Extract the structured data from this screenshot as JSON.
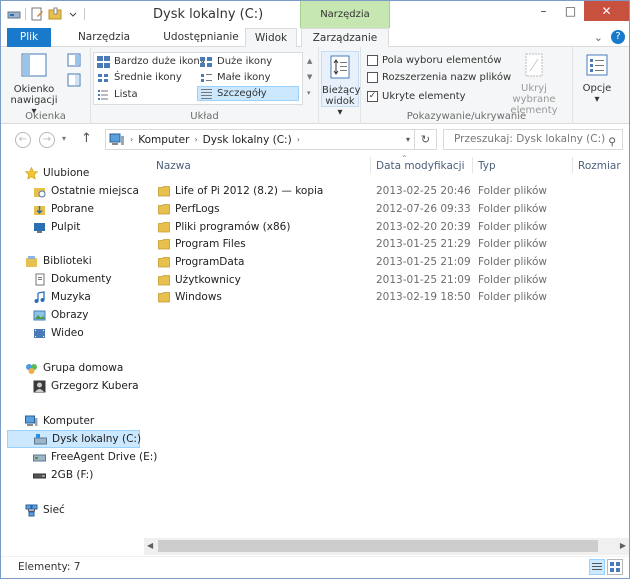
{
  "window": {
    "title": "Dysk lokalny (C:)",
    "context_tab": "Narzędzia dysków",
    "controls": {
      "minimize": "–",
      "maximize": "□",
      "close": "✕"
    }
  },
  "tabs": {
    "file": "Plik",
    "home": "Narzędzia główne",
    "share": "Udostępnianie",
    "view": "Widok",
    "manage": "Zarządzanie"
  },
  "ribbon": {
    "panes": {
      "label": "Okienka",
      "nav_pane_line1": "Okienko",
      "nav_pane_line2": "nawigacji"
    },
    "layout": {
      "label": "Układ",
      "items": {
        "extra_large": "Bardzo duże ikony",
        "large": "Duże ikony",
        "medium": "Średnie ikony",
        "small": "Małe ikony",
        "list": "Lista",
        "details": "Szczegóły"
      }
    },
    "current_view": {
      "line1": "Bieżący",
      "line2": "widok"
    },
    "show_hide": {
      "label": "Pokazywanie/ukrywanie",
      "item_checkboxes": "Pola wyboru elementów",
      "item_checkboxes_checked": false,
      "file_extensions": "Rozszerzenia nazw plików",
      "file_extensions_checked": false,
      "hidden_items": "Ukryte elementy",
      "hidden_items_checked": true,
      "hide_selected_line1": "Ukryj wybrane",
      "hide_selected_line2": "elementy"
    },
    "options": "Opcje"
  },
  "address": {
    "crumbs": [
      "Komputer",
      "Dysk lokalny (C:)"
    ],
    "search_placeholder": "Przeszukaj: Dysk lokalny (C:)"
  },
  "navigation": {
    "favorites": {
      "label": "Ulubione",
      "items": [
        "Ostatnie miejsca",
        "Pobrane",
        "Pulpit"
      ]
    },
    "libraries": {
      "label": "Biblioteki",
      "items": [
        "Dokumenty",
        "Muzyka",
        "Obrazy",
        "Wideo"
      ]
    },
    "homegroup": {
      "label": "Grupa domowa",
      "items": [
        "Grzegorz Kubera"
      ]
    },
    "computer": {
      "label": "Komputer",
      "items": [
        "Dysk lokalny (C:)",
        "FreeAgent Drive (E:)",
        "2GB (F:)"
      ]
    },
    "network": {
      "label": "Sieć"
    }
  },
  "columns": {
    "name": "Nazwa",
    "date": "Data modyfikacji",
    "type": "Typ",
    "size": "Rozmiar"
  },
  "files": [
    {
      "name": "Life of Pi 2012  (8.2) — kopia",
      "date": "2013-02-25 20:46",
      "type": "Folder plików"
    },
    {
      "name": "PerfLogs",
      "date": "2012-07-26 09:33",
      "type": "Folder plików"
    },
    {
      "name": "Pliki programów (x86)",
      "date": "2013-02-20 20:39",
      "type": "Folder plików"
    },
    {
      "name": "Program Files",
      "date": "2013-01-25 21:29",
      "type": "Folder plików"
    },
    {
      "name": "ProgramData",
      "date": "2013-01-25 21:09",
      "type": "Folder plików"
    },
    {
      "name": "Użytkownicy",
      "date": "2013-01-25 21:09",
      "type": "Folder plików"
    },
    {
      "name": "Windows",
      "date": "2013-02-19 18:50",
      "type": "Folder plików"
    }
  ],
  "status": {
    "items": "Elementy: 7"
  },
  "colors": {
    "accent": "#1979ca",
    "context_tab": "#c6e7b2",
    "selection": "#cce8ff",
    "folder": "#e8c04e"
  }
}
